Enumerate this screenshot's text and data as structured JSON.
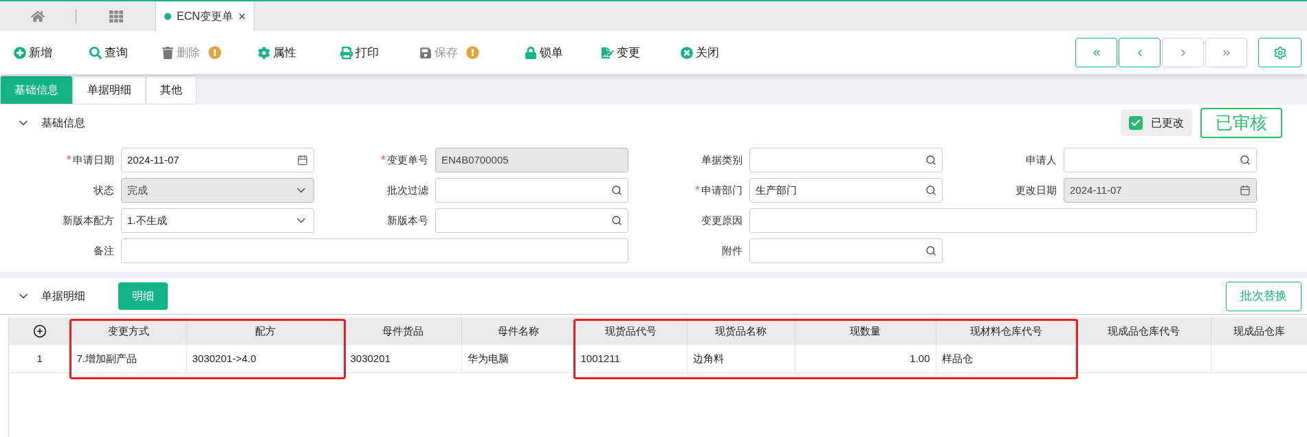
{
  "doc_tabs": [
    {
      "kind": "home",
      "selected": false
    },
    {
      "kind": "grid",
      "selected": false
    },
    {
      "kind": "doc",
      "label": "ECN变更单",
      "close": "×",
      "selected": true
    }
  ],
  "toolbar": [
    {
      "label": "新增",
      "disabled": false,
      "warning": false
    },
    {
      "label": "查询",
      "disabled": false,
      "warning": false
    },
    {
      "label": "删除",
      "disabled": true,
      "warning": true
    },
    {
      "label": "属性",
      "disabled": false,
      "warning": false
    },
    {
      "label": "打印",
      "disabled": false,
      "warning": false
    },
    {
      "label": "保存",
      "disabled": true,
      "warning": true
    },
    {
      "label": "锁单",
      "disabled": false,
      "warning": false
    },
    {
      "label": "变更",
      "disabled": false,
      "warning": false
    },
    {
      "label": "关闭",
      "disabled": false,
      "warning": false
    }
  ],
  "nav_buttons": [
    {
      "disabled": false
    },
    {
      "disabled": false
    },
    {
      "disabled": true
    },
    {
      "disabled": true
    }
  ],
  "tabs": [
    {
      "label": "基础信息",
      "selected": true
    },
    {
      "label": "单据明细",
      "selected": false
    },
    {
      "label": "其他",
      "selected": false
    }
  ],
  "basic_section": {
    "title": "基础信息",
    "expanded": true,
    "changed": {
      "label": "已更改",
      "checked": true
    },
    "stamp": "已审核"
  },
  "fields": [
    {
      "label": "申请日期",
      "required_mark": "*",
      "kind": "date",
      "value": "2024-11-07",
      "readonly": false
    },
    {
      "label": "变更单号",
      "required_mark": "*",
      "kind": "text",
      "value": "EN4B0700005",
      "readonly": true
    },
    {
      "label": "单据类别",
      "kind": "lookup",
      "readonly": false
    },
    {
      "label": "申请人",
      "kind": "lookup",
      "readonly": false
    },
    {
      "label": "状态",
      "kind": "select",
      "value": "完成",
      "readonly": true
    },
    {
      "label": "批次过滤",
      "kind": "lookup",
      "readonly": false
    },
    {
      "label": "申请部门",
      "required_mark": "*",
      "kind": "lookup",
      "value": "生产部门",
      "readonly": false
    },
    {
      "label": "更改日期",
      "kind": "date",
      "value": "2024-11-07",
      "readonly": true
    },
    {
      "label": "新版本配方",
      "kind": "select",
      "value": "1.不生成",
      "readonly": false
    },
    {
      "label": "新版本号",
      "kind": "lookup",
      "readonly": false
    },
    {
      "label": "变更原因",
      "kind": "text",
      "readonly": false,
      "wide": true
    },
    {
      "label": "备注",
      "kind": "text",
      "readonly": false,
      "wide": true
    },
    {
      "label": "附件",
      "kind": "lookup",
      "readonly": false
    }
  ],
  "detail_section": {
    "title": "单据明细",
    "expanded": true,
    "button": "明细",
    "action": "批次替换"
  },
  "table": {
    "columns": [
      {
        "highlighted": false
      },
      {
        "label": "变更方式",
        "highlighted": true
      },
      {
        "label": "配方",
        "highlighted": true
      },
      {
        "label": "母件货品",
        "highlighted": false
      },
      {
        "label": "母件名称",
        "highlighted": false
      },
      {
        "label": "现货品代号",
        "highlighted": true
      },
      {
        "label": "现货品名称",
        "highlighted": true
      },
      {
        "label": "现数量",
        "highlighted": true
      },
      {
        "label": "现材料仓库代号",
        "highlighted": true
      },
      {
        "label": "现成品仓库代号",
        "highlighted": false
      },
      {
        "label": "现成品仓库",
        "highlighted": false
      }
    ],
    "rows": [
      [
        "1",
        "7.增加副产品",
        "3030201->4.0",
        "3030201",
        "华为电脑",
        "1001211",
        "边角料",
        "1.00",
        "样品仓",
        "",
        ""
      ]
    ]
  }
}
